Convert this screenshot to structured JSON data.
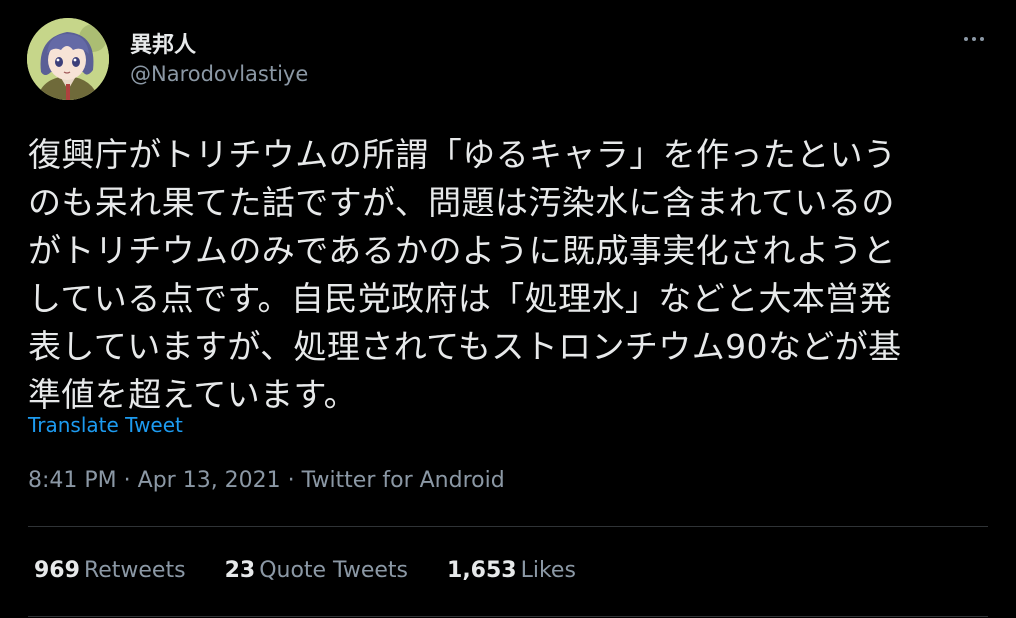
{
  "author": {
    "display_name": "異邦人",
    "handle": "@Narodovlastiye",
    "avatar_icon": "anime-avatar-icon"
  },
  "tweet": {
    "lines": [
      "復興庁がトリチウムの所謂「ゆるキャラ」を作ったという",
      "のも呆れ果てた話ですが、問題は汚染水に含まれているの",
      "がトリチウムのみであるかのように既成事実化されようと",
      "している点です。自民党政府は「処理水」などと大本営発",
      "表していますが、処理されてもストロンチウム90などが基",
      "準値を超えています。"
    ],
    "translate_label": "Translate Tweet"
  },
  "meta": {
    "time": "8:41 PM",
    "date": "Apr 13, 2021",
    "source": "Twitter for Android",
    "separator": " · "
  },
  "stats": {
    "retweets_count": "969",
    "retweets_label": "Retweets",
    "quotes_count": "23",
    "quotes_label": "Quote Tweets",
    "likes_count": "1,653",
    "likes_label": "Likes"
  },
  "colors": {
    "background": "#000000",
    "text": "#e7e9ea",
    "secondary": "#8b98a5",
    "link": "#1d9bf0",
    "divider": "#2f3336"
  },
  "icons": {
    "more": "more-options-icon"
  }
}
